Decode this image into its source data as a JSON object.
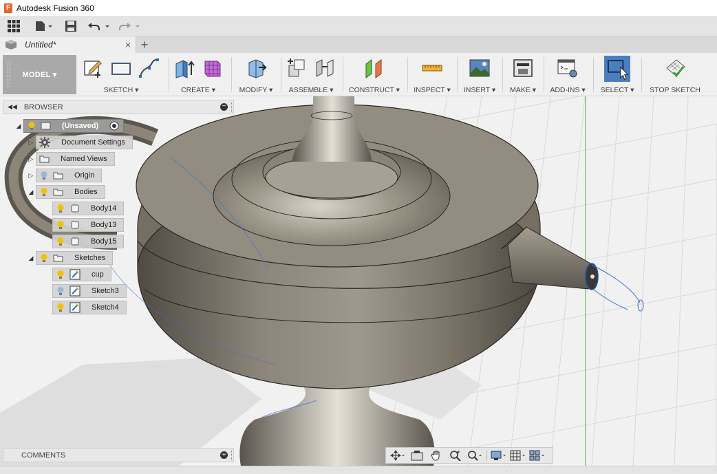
{
  "window": {
    "title": "Autodesk Fusion 360",
    "logo_letter": "F"
  },
  "document_tab": {
    "name": "Untitled*",
    "close_glyph": "×",
    "new_tab_glyph": "+"
  },
  "workspace": {
    "label": "MODEL ▾"
  },
  "toolbar_groups": [
    {
      "label": "SKETCH ▾"
    },
    {
      "label": "CREATE ▾"
    },
    {
      "label": "MODIFY ▾"
    },
    {
      "label": "ASSEMBLE ▾"
    },
    {
      "label": "CONSTRUCT ▾"
    },
    {
      "label": "INSPECT ▾"
    },
    {
      "label": "INSERT ▾"
    },
    {
      "label": "MAKE ▾"
    },
    {
      "label": "ADD-INS ▾"
    },
    {
      "label": "SELECT ▾"
    },
    {
      "label": "STOP SKETCH"
    }
  ],
  "browser": {
    "title": "BROWSER",
    "root": "(Unsaved)",
    "items": [
      {
        "label": "Document Settings"
      },
      {
        "label": "Named Views"
      },
      {
        "label": "Origin"
      },
      {
        "label": "Bodies"
      },
      {
        "label": "Body14"
      },
      {
        "label": "Body13"
      },
      {
        "label": "Body15"
      },
      {
        "label": "Sketches"
      },
      {
        "label": "cup"
      },
      {
        "label": "Sketch3"
      },
      {
        "label": "Sketch4"
      }
    ]
  },
  "comments": {
    "title": "COMMENTS"
  },
  "colors": {
    "select_active": "#4a7fbd",
    "bulb_on": "#f2c200",
    "bulb_off": "#9ab8d8",
    "model_surface": "#7d776c"
  }
}
